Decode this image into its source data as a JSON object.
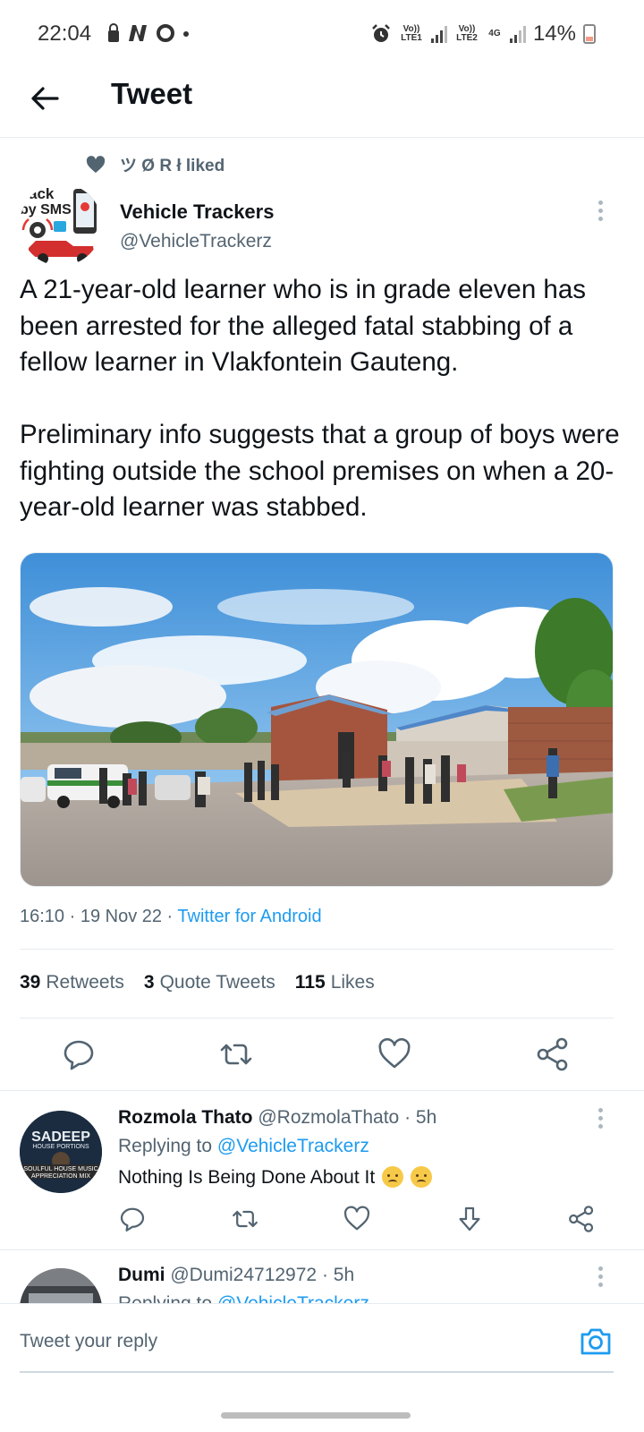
{
  "status_bar": {
    "time": "22:04",
    "network_1": "Vo)) LTE1",
    "network_2": "Vo)) LTE2",
    "network_type": "4G",
    "battery": "14%"
  },
  "header": {
    "title": "Tweet"
  },
  "liked_by": "ツ Ø R ł liked",
  "author": {
    "avatar_text_1": "ack",
    "avatar_text_2": "by SMS",
    "name": "Vehicle Trackers",
    "handle": "@VehicleTrackerz"
  },
  "tweet": {
    "paragraph_1": "A 21-year-old learner who is in grade eleven has been arrested for the alleged fatal stabbing of a fellow learner in Vlakfontein Gauteng.",
    "paragraph_2": "Preliminary info suggests that a group of boys were fighting outside the school premises on when a 20-year-old learner was stabbed.",
    "time": "16:10 · 19 Nov 22 · ",
    "source": "Twitter for Android"
  },
  "stats": {
    "retweets_count": "39",
    "retweets_label": "Retweets",
    "quotes_count": "3",
    "quotes_label": "Quote Tweets",
    "likes_count": "115",
    "likes_label": "Likes"
  },
  "actions": [
    "reply-icon",
    "retweet-icon",
    "like-icon",
    "share-icon"
  ],
  "replies": [
    {
      "avatar_text_1": "SADEEP",
      "avatar_text_2": "HOUSE PORTIONS",
      "avatar_text_3": "SOULFUL HOUSE MUSIC",
      "avatar_text_4": "APPRECIATION MIX",
      "name": "Rozmola Thato",
      "handle": "@RozmolaThato",
      "time": "· 5h",
      "replying_prefix": "Replying to ",
      "replying_handle": "@VehicleTrackerz",
      "body": "Nothing Is Being Done About It"
    },
    {
      "name": "Dumi",
      "handle": "@Dumi24712972",
      "time": "· 5h",
      "replying_prefix": "Replying to ",
      "replying_handle": "@VehicleTrackerz"
    }
  ],
  "composer": {
    "placeholder": "Tweet your reply"
  },
  "colors": {
    "accent": "#1d9bf0",
    "muted": "#536471",
    "text": "#0f1419"
  }
}
